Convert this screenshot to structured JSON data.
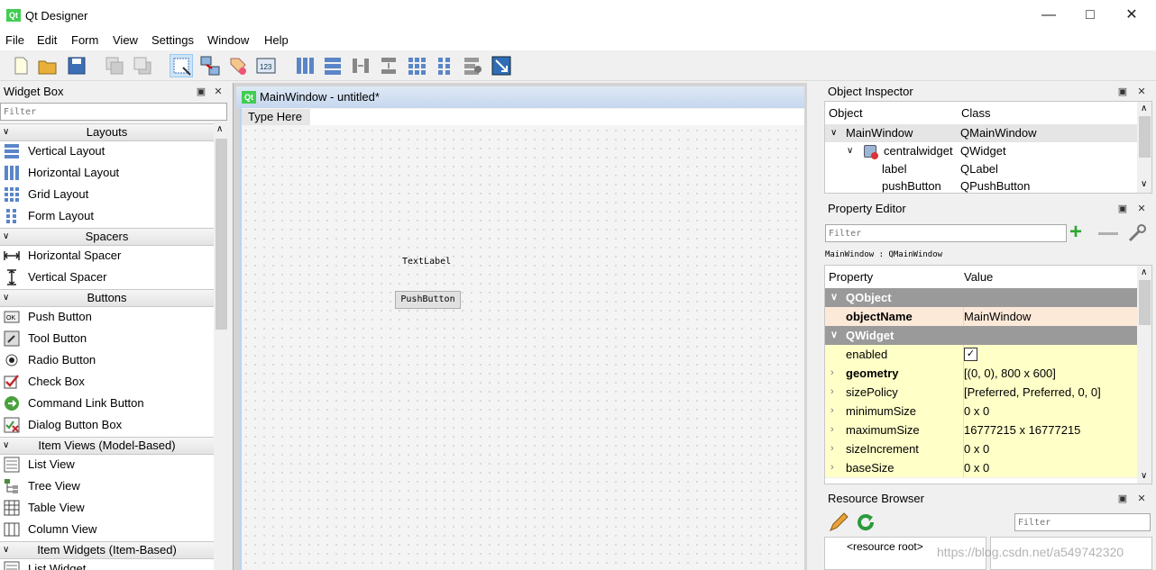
{
  "window": {
    "title": "Qt Designer",
    "app_icon_text": "Qt"
  },
  "menu": [
    "File",
    "Edit",
    "Form",
    "View",
    "Settings",
    "Window",
    "Help"
  ],
  "toolbar_icons": [
    "new-icon",
    "open-icon",
    "save-icon",
    "send-to-back-icon",
    "bring-to-front-icon",
    "edit-widgets-icon",
    "edit-signals-slots-icon",
    "edit-buddies-icon",
    "edit-tab-order-icon",
    "lay-out-horizontally-icon",
    "lay-out-vertically-icon",
    "lay-out-horizontal-splitter-icon",
    "lay-out-vertical-splitter-icon",
    "lay-out-grid-icon",
    "lay-out-form-icon",
    "break-layout-icon",
    "adjust-size-icon"
  ],
  "widget_box": {
    "title": "Widget Box",
    "filter_placeholder": "Filter",
    "categories": [
      {
        "label": "Layouts",
        "items": [
          "Vertical Layout",
          "Horizontal Layout",
          "Grid Layout",
          "Form Layout"
        ]
      },
      {
        "label": "Spacers",
        "items": [
          "Horizontal Spacer",
          "Vertical Spacer"
        ]
      },
      {
        "label": "Buttons",
        "items": [
          "Push Button",
          "Tool Button",
          "Radio Button",
          "Check Box",
          "Command Link Button",
          "Dialog Button Box"
        ]
      },
      {
        "label": "Item Views (Model-Based)",
        "items": [
          "List View",
          "Tree View",
          "Table View",
          "Column View"
        ]
      },
      {
        "label": "Item Widgets (Item-Based)",
        "items": [
          "List Widget"
        ]
      }
    ]
  },
  "form": {
    "title": "MainWindow - untitled*",
    "menu_placeholder": "Type Here",
    "label_text": "TextLabel",
    "button_text": "PushButton"
  },
  "object_inspector": {
    "title": "Object Inspector",
    "col_object": "Object",
    "col_class": "Class",
    "rows": [
      {
        "object": "MainWindow",
        "class": "QMainWindow"
      },
      {
        "object": "centralwidget",
        "class": "QWidget"
      },
      {
        "object": "label",
        "class": "QLabel"
      },
      {
        "object": "pushButton",
        "class": "QPushButton"
      }
    ]
  },
  "property_editor": {
    "title": "Property Editor",
    "filter_placeholder": "Filter",
    "context": "MainWindow : QMainWindow",
    "col_property": "Property",
    "col_value": "Value",
    "group_qobject": "QObject",
    "group_qwidget": "QWidget",
    "rows": [
      {
        "name": "objectName",
        "value": "MainWindow"
      },
      {
        "name": "enabled",
        "value": "✓"
      },
      {
        "name": "geometry",
        "value": "[(0, 0), 800 x 600]"
      },
      {
        "name": "sizePolicy",
        "value": "[Preferred, Preferred, 0, 0]"
      },
      {
        "name": "minimumSize",
        "value": "0 x 0"
      },
      {
        "name": "maximumSize",
        "value": "16777215 x 16777215"
      },
      {
        "name": "sizeIncrement",
        "value": "0 x 0"
      },
      {
        "name": "baseSize",
        "value": "0 x 0"
      }
    ]
  },
  "resource_browser": {
    "title": "Resource Browser",
    "filter_placeholder": "Filter",
    "root_label": "<resource root>",
    "watermark": "https://blog.csdn.net/a549742320"
  }
}
